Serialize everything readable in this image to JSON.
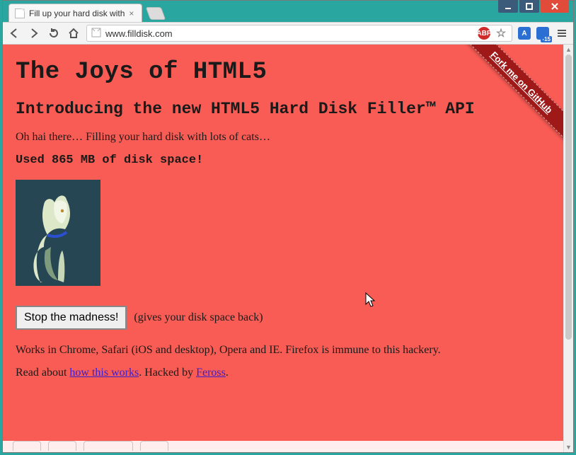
{
  "window": {
    "titlebar": {
      "minimize": "minimize",
      "maximize": "maximize",
      "close": "close"
    }
  },
  "browser": {
    "tab": {
      "title": "Fill up your hard disk with",
      "close": "×"
    },
    "nav": {
      "back": "back",
      "forward": "forward",
      "reload": "reload",
      "home": "home"
    },
    "omnibox": {
      "url": "www.filldisk.com"
    },
    "extensions": {
      "abp": "ABP",
      "star": "☆",
      "translate": "A",
      "square_badge": "-15"
    },
    "menu": "≡"
  },
  "page": {
    "ribbon": "Fork me on GitHub",
    "h1": "The Joys of HTML5",
    "h2": "Introducing the new HTML5 Hard Disk Filler™ API",
    "intro": "Oh hai there… Filling your hard disk with lots of cats…",
    "used_prefix": "Used ",
    "used_value": "865 MB",
    "used_suffix": " of disk space!",
    "stop_button": "Stop the madness!",
    "stop_hint": "(gives your disk space back)",
    "works": "Works in Chrome, Safari (iOS and desktop), Opera and IE. Firefox is immune to this hackery.",
    "read_prefix": "Read about ",
    "read_link": "how this works",
    "read_mid": ". Hacked by ",
    "read_author": "Feross",
    "read_suffix": "."
  }
}
